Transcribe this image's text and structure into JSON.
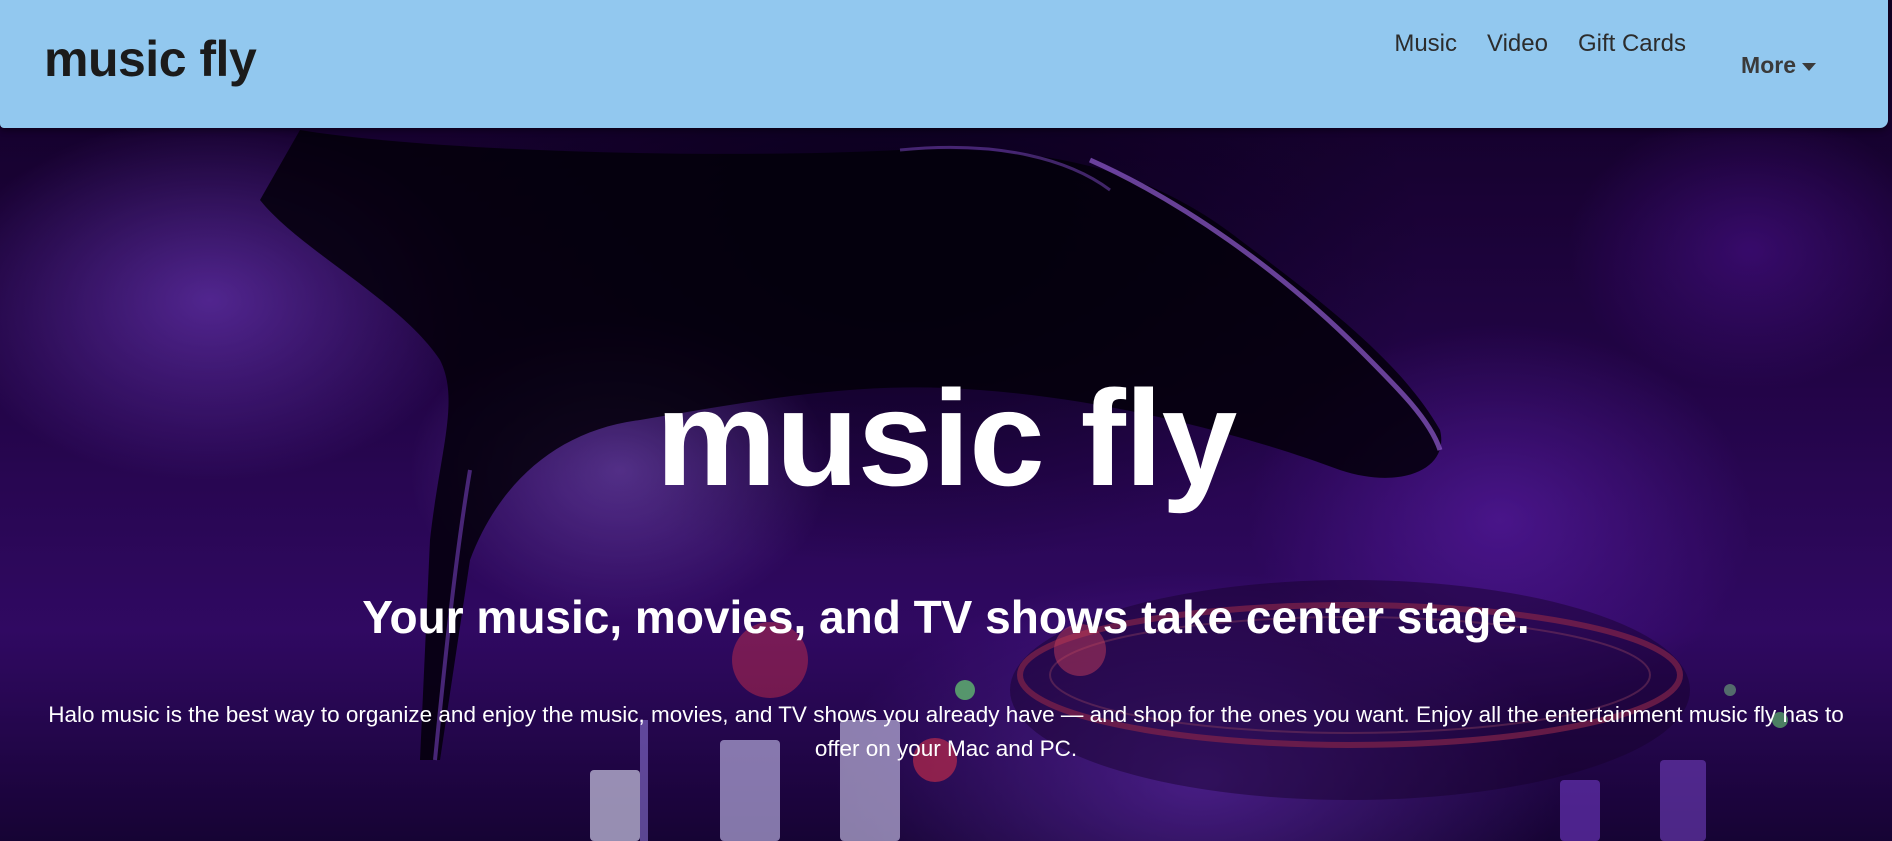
{
  "navbar": {
    "brand": "music fly",
    "links": [
      {
        "label": "Music"
      },
      {
        "label": "Video"
      },
      {
        "label": "Gift Cards"
      }
    ],
    "more_label": "More",
    "background_color": "#92c8ef"
  },
  "hero": {
    "title": "music fly",
    "subtitle": "Your music, movies, and TV shows take center stage.",
    "description": "Halo music is the best way to organize and enjoy the music, movies, and TV shows you already have — and shop for the ones you want. Enjoy all the entertainment music fly has to offer on your Mac and PC.",
    "accent_color": "#7b2cff"
  }
}
